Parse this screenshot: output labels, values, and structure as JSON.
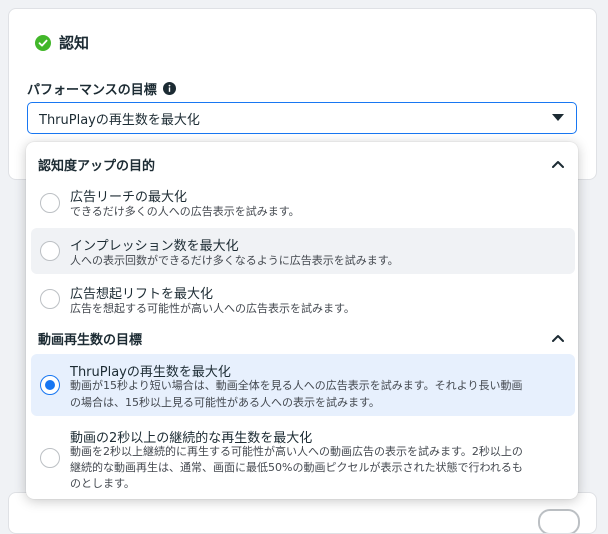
{
  "section": {
    "title": "認知"
  },
  "performance_goal": {
    "label": "パフォーマンスの目標",
    "selected": "ThruPlayの再生数を最大化"
  },
  "dropdown": {
    "groups": [
      {
        "title": "認知度アップの目的",
        "options": [
          {
            "title": "広告リーチの最大化",
            "desc": "できるだけ多くの人への広告表示を試みます。"
          },
          {
            "title": "インプレッション数を最大化",
            "desc": "人への表示回数ができるだけ多くなるように広告表示を試みます。"
          },
          {
            "title": "広告想起リフトを最大化",
            "desc": "広告を想起する可能性が高い人への広告表示を試みます。"
          }
        ]
      },
      {
        "title": "動画再生数の目標",
        "options": [
          {
            "title": "ThruPlayの再生数を最大化",
            "desc1": "動画が15秒より短い場合は、動画全体を見る人への広告表示を試みます。それより長い動画",
            "desc2": "の場合は、15秒以上見る可能性がある人への表示を試みます。"
          },
          {
            "title": "動画の2秒以上の継続的な再生数を最大化",
            "desc1": "動画を2秒以上継続的に再生する可能性が高い人への動画広告の表示を試みます。2秒以上の",
            "desc2": "継続的な動画再生は、通常、画面に最低50%の動画ピクセルが表示された状態で行われるも",
            "desc3": "のとします。"
          }
        ]
      }
    ]
  },
  "colors": {
    "accent": "#1877f2",
    "check": "#42b72a",
    "selected_bg": "#e7f0fd",
    "hover_bg": "#f0f2f5"
  }
}
